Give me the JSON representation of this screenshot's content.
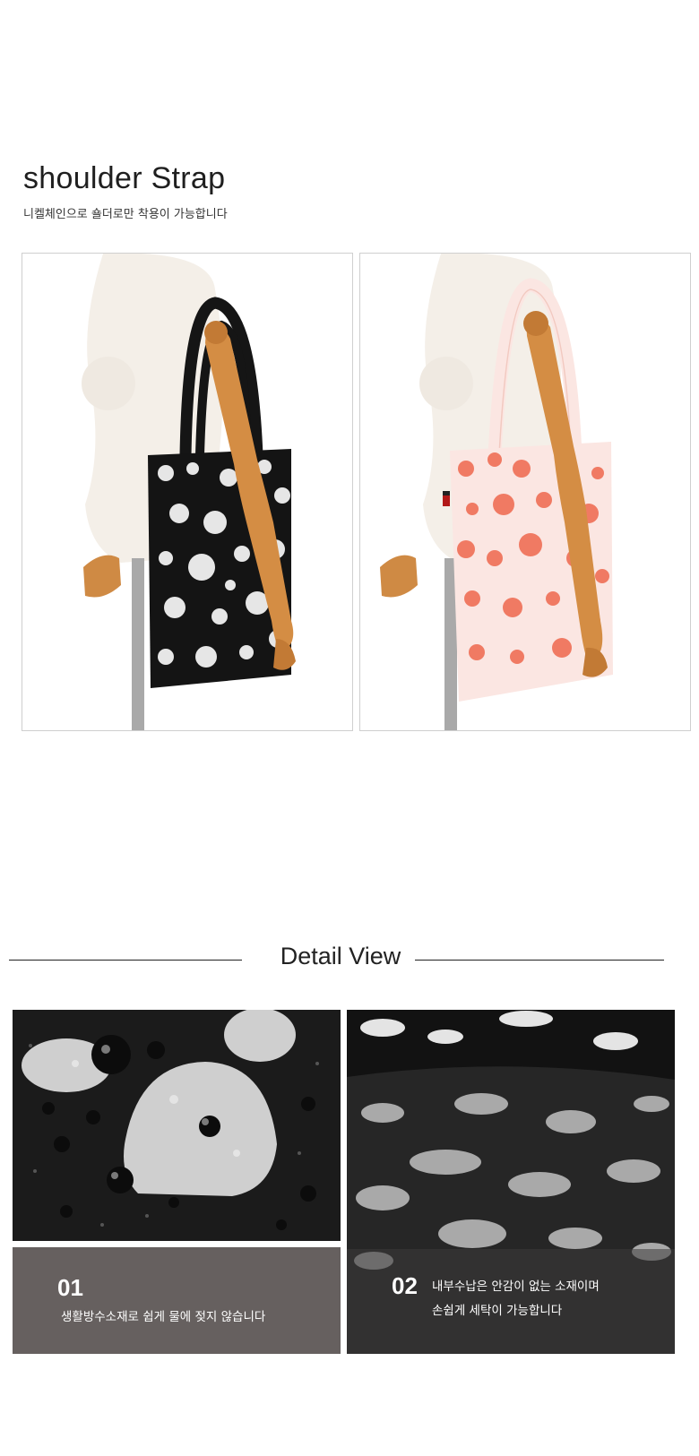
{
  "shoulder_section": {
    "title": "shoulder Strap",
    "subtitle": "니켈체인으로 숄더로만 착용이 가능합니다"
  },
  "photos": [
    {
      "name": "black-polka-dot-bag",
      "bag_color": "#141414",
      "dot_color": "#e9e9e9"
    },
    {
      "name": "pink-polka-dot-bag",
      "bag_color": "#fbe6e2",
      "dot_color": "#f07a63"
    }
  ],
  "detail_section": {
    "title": "Detail View",
    "items": [
      {
        "number": "01",
        "lines": [
          "생활방수소재로 쉽게 물에 젖지 않습니다"
        ]
      },
      {
        "number": "02",
        "lines": [
          "내부수납은 안감이 없는 소재이며",
          "손쉽게 세탁이 가능합니다"
        ]
      }
    ]
  }
}
